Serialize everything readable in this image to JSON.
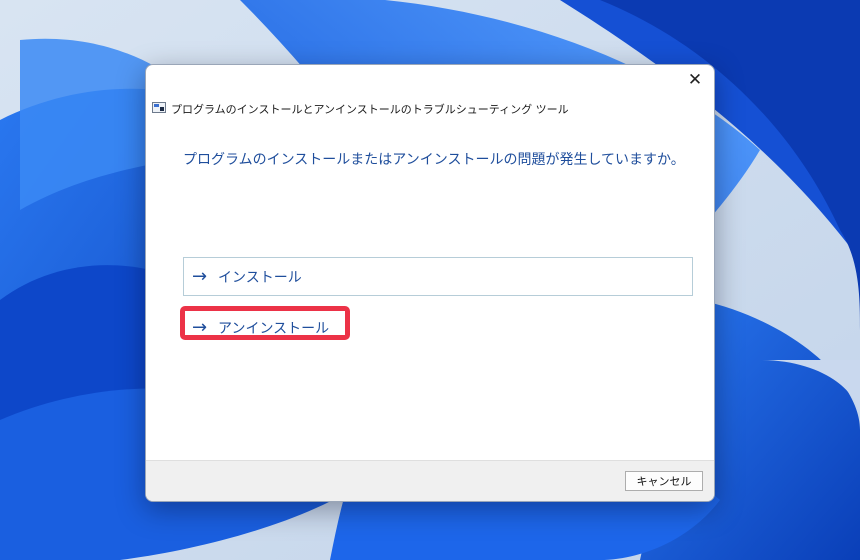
{
  "dialog": {
    "title": "プログラムのインストールとアンインストールのトラブルシューティング ツール",
    "close_label": "✕",
    "question": "プログラムのインストールまたはアンインストールの問題が発生していますか。",
    "options": [
      {
        "arrow": "→",
        "label": "インストール"
      },
      {
        "arrow": "→",
        "label": "アンインストール"
      }
    ],
    "cancel_label": "キャンセル"
  },
  "colors": {
    "accent_text": "#1f4e9c",
    "highlight": "#ec3247",
    "wallpaper": "#1b5fd6"
  },
  "icons": [
    "close-icon",
    "app-icon",
    "arrow-right-icon"
  ]
}
